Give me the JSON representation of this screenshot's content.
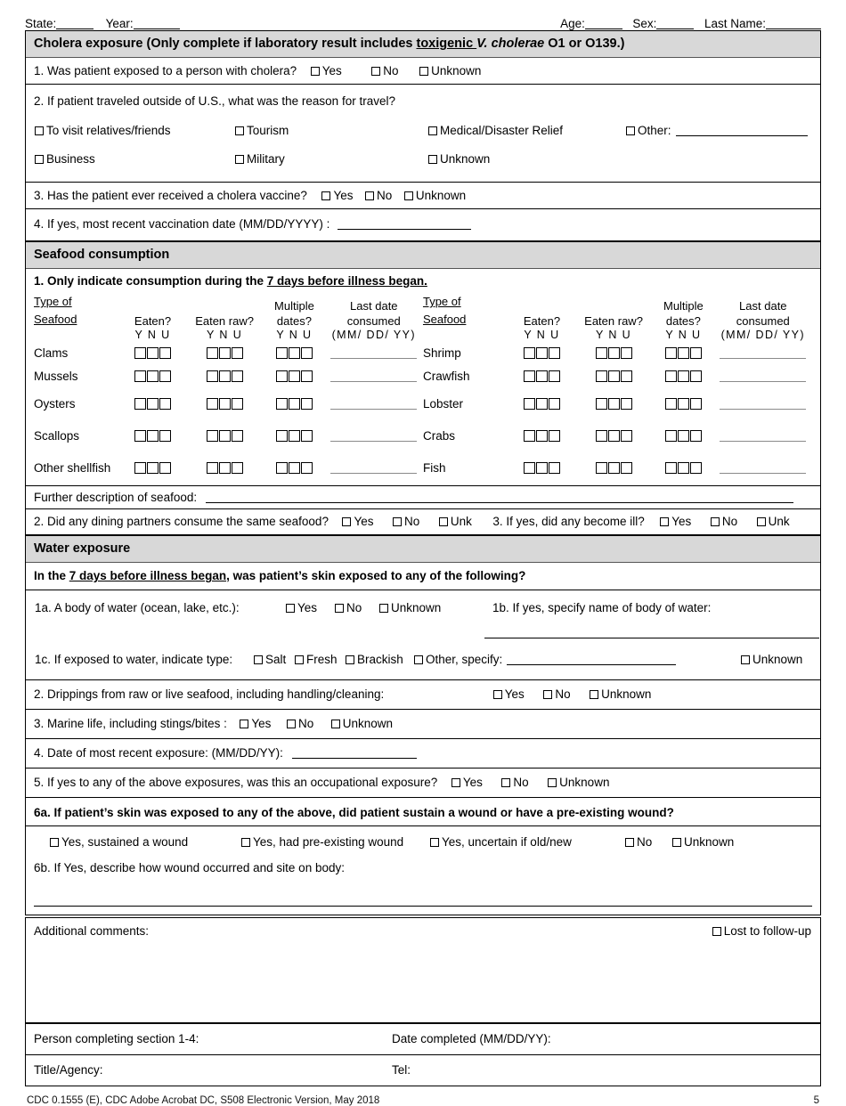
{
  "header": {
    "state_label": "State:",
    "year_label": "Year:",
    "age_label": "Age:",
    "sex_label": "Sex:",
    "lastname_label": "Last Name:"
  },
  "cholera": {
    "section_title_a": "Cholera exposure  (Only complete if laboratory result includes ",
    "section_title_underlined": "toxigenic ",
    "section_title_italic": "V. cholerae",
    "section_title_b": " O1 or O139.)",
    "q1": "1. Was patient exposed to a person with cholera?",
    "q1_options": [
      "Yes",
      "No",
      "Unknown"
    ],
    "q2": "2. If patient traveled outside of U.S., what was the reason for travel?",
    "q2_options_row1": [
      "To visit relatives/friends",
      "Tourism",
      "Medical/Disaster Relief",
      "Other:"
    ],
    "q2_options_row2": [
      "Business",
      "Military",
      "Unknown"
    ],
    "q3": "3. Has the patient ever received a cholera vaccine?",
    "q3_options": [
      "Yes",
      "No",
      "Unknown"
    ],
    "q4": "4. If yes, most recent vaccination date (MM/DD/YYYY) :"
  },
  "seafood": {
    "section_title": "Seafood consumption",
    "q1_a": "1. Only indicate consumption during the ",
    "q1_underlined": "7 days before illness began.",
    "columns": {
      "type_line1": "Type of",
      "type_line2": "Seafood",
      "eaten": "Eaten?",
      "eaten_raw": "Eaten raw?",
      "multiple_line1": "Multiple",
      "multiple_line2": "dates?",
      "lastdate_line1": "Last date",
      "lastdate_line2": "consumed",
      "ynu": "Y N U",
      "date_format": "(MM/ DD/ YY)"
    },
    "left_rows": [
      "Clams",
      "Mussels",
      "Oysters",
      "Scallops",
      "Other shellfish"
    ],
    "right_rows": [
      "Shrimp",
      "Crawfish",
      "Lobster",
      "Crabs",
      "Fish"
    ],
    "further_desc": "Further description of seafood:",
    "q2": "2. Did any dining partners consume the same seafood?",
    "q2_options": [
      "Yes",
      "No",
      "Unk"
    ],
    "q3": "3. If yes, did any become ill?",
    "q3_options": [
      "Yes",
      "No",
      "Unk"
    ]
  },
  "water": {
    "section_title": "Water exposure",
    "intro_a": "In the ",
    "intro_underlined": "7 days before illness began",
    "intro_b": ", was patient’s skin exposed to any of the following?",
    "q1a": "1a. A body of water (ocean, lake, etc.):",
    "q1a_options": [
      "Yes",
      "No",
      "Unknown"
    ],
    "q1b": "1b. If yes, specify name of body of water:",
    "q1c": "1c. If exposed to water, indicate type:",
    "q1c_options": [
      "Salt",
      "Fresh",
      "Brackish",
      "Other, specify:"
    ],
    "q1c_unknown": "Unknown",
    "q2": "2. Drippings from raw or live seafood, including handling/cleaning:",
    "q2_options": [
      "Yes",
      "No",
      "Unknown"
    ],
    "q3": "3. Marine life, including stings/bites :",
    "q3_options": [
      "Yes",
      "No",
      "Unknown"
    ],
    "q4": "4. Date of most recent exposure: (MM/DD/YY):",
    "q5": "5. If yes to any of the above exposures, was this an occupational exposure?",
    "q5_options": [
      "Yes",
      "No",
      "Unknown"
    ],
    "q6a": "6a. If patient’s skin was exposed to any of the above, did patient sustain a wound or have a pre-existing wound?",
    "q6a_options": [
      "Yes, sustained a wound",
      "Yes, had pre-existing wound",
      "Yes, uncertain if old/new",
      "No",
      "Unknown"
    ],
    "q6b": "6b. If Yes, describe how wound occurred and site on body:"
  },
  "bottom": {
    "additional_comments": "Additional comments:",
    "lost_to_followup": "Lost to follow-up",
    "person_completing": "Person completing section 1-4:",
    "date_completed": "Date completed (MM/DD/YY):",
    "title_agency": "Title/Agency:",
    "tel": "Tel:"
  },
  "footer": {
    "doc_id": "CDC 0.1555 (E), CDC Adobe Acrobat DC, S508 Electronic Version, May 2018",
    "page_number": "5"
  },
  "colors": {
    "section_header_bg": "#d8d8d8",
    "border": "#000000",
    "blank_line_gray": "#8a8a8a"
  }
}
